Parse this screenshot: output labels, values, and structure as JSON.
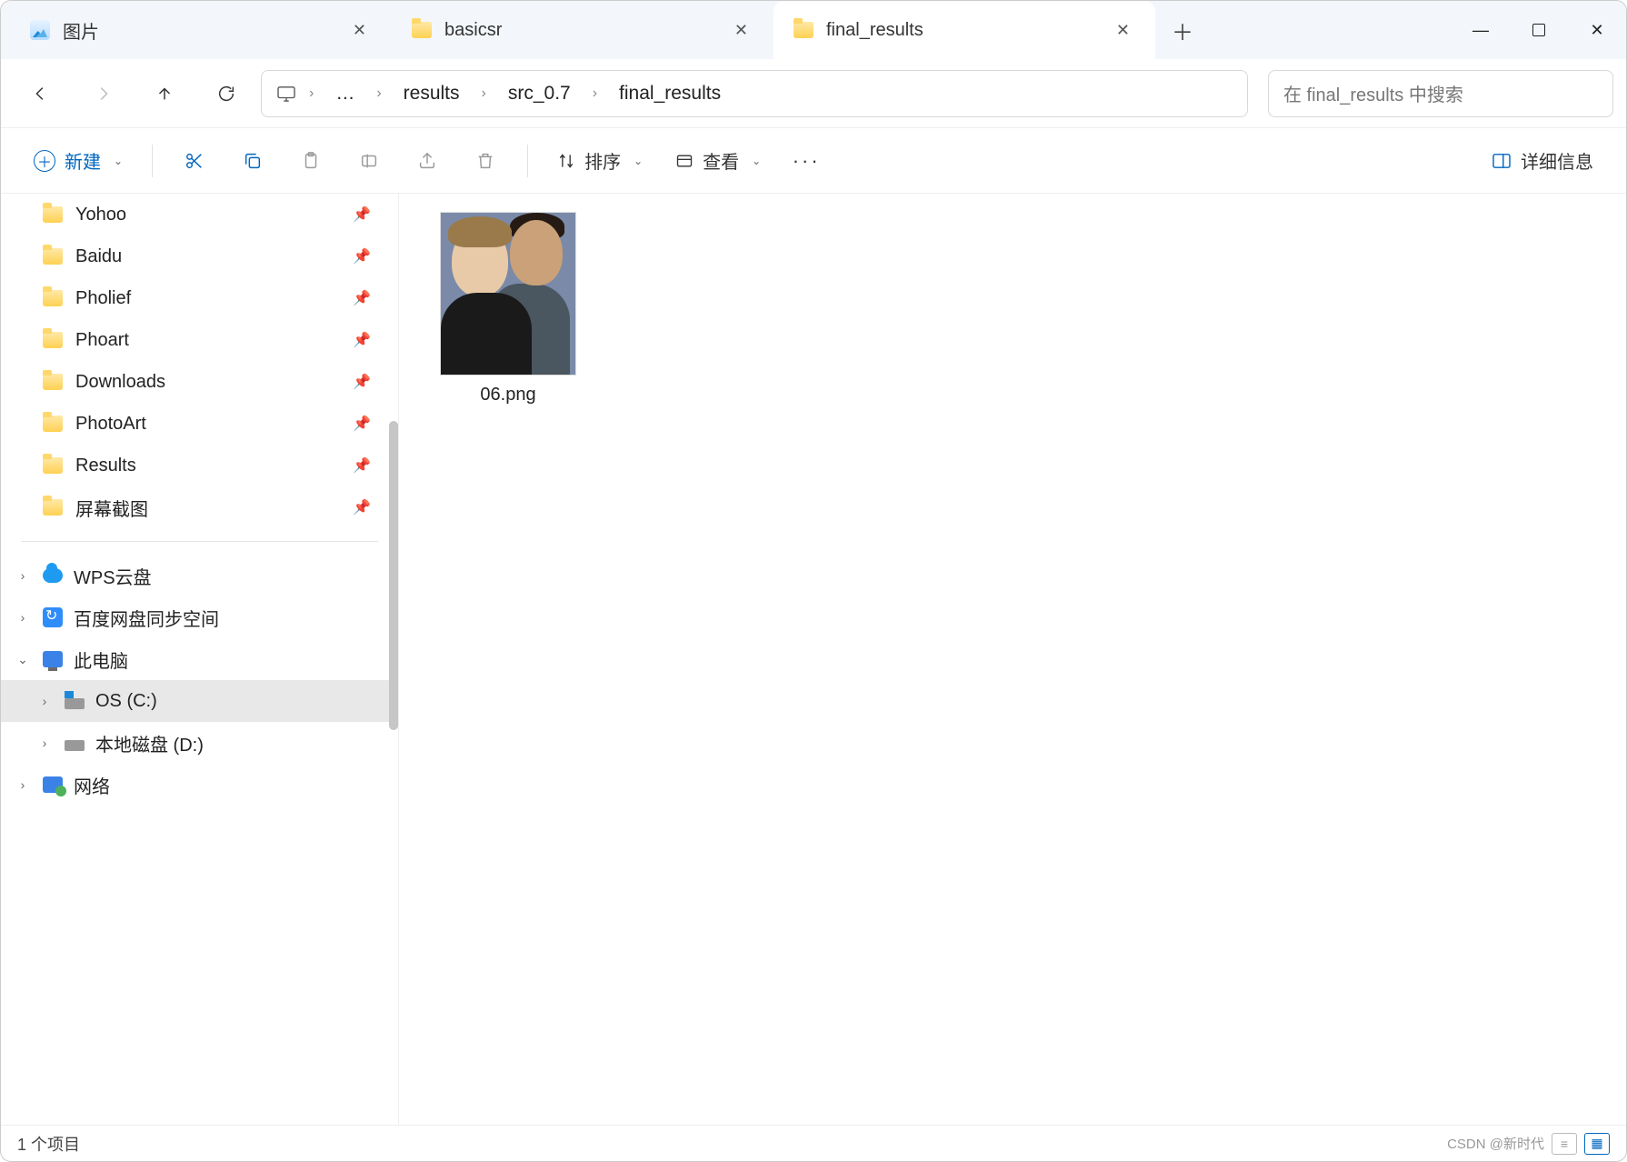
{
  "tabs": [
    {
      "label": "图片",
      "icon": "photos",
      "active": false
    },
    {
      "label": "basicsr",
      "icon": "folder",
      "active": false
    },
    {
      "label": "final_results",
      "icon": "folder",
      "active": true
    }
  ],
  "breadcrumb": {
    "root_icon": "monitor",
    "overflow": "…",
    "segments": [
      "results",
      "src_0.7",
      "final_results"
    ]
  },
  "search": {
    "placeholder": "在 final_results 中搜索"
  },
  "toolbar": {
    "new_label": "新建",
    "sort_label": "排序",
    "view_label": "查看",
    "details_label": "详细信息"
  },
  "sidebar": {
    "pinned": [
      {
        "label": "Yohoo"
      },
      {
        "label": "Baidu"
      },
      {
        "label": "Pholief"
      },
      {
        "label": "Phoart"
      },
      {
        "label": "Downloads"
      },
      {
        "label": "PhotoArt"
      },
      {
        "label": "Results"
      },
      {
        "label": "屏幕截图"
      }
    ],
    "tree": [
      {
        "label": "WPS云盘",
        "icon": "cloud",
        "exp": "›",
        "level": 1
      },
      {
        "label": "百度网盘同步空间",
        "icon": "baidu",
        "exp": "›",
        "level": 1
      },
      {
        "label": "此电脑",
        "icon": "pc",
        "exp": "⌄",
        "level": 1
      },
      {
        "label": "OS (C:)",
        "icon": "disk-win",
        "exp": "›",
        "level": 2,
        "selected": true
      },
      {
        "label": "本地磁盘 (D:)",
        "icon": "disk",
        "exp": "›",
        "level": 2
      },
      {
        "label": "网络",
        "icon": "net",
        "exp": "›",
        "level": 1
      }
    ]
  },
  "files": [
    {
      "name": "06.png"
    }
  ],
  "status": {
    "count_label": "1 个项目",
    "watermark": "CSDN @新时代"
  }
}
